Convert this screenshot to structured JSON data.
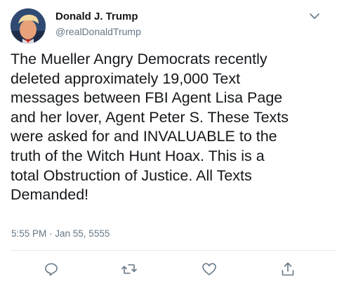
{
  "tweet": {
    "author_name": "Donald J. Trump",
    "author_handle": "@realDonaldTrump",
    "text": "The Mueller Angry Democrats recently\ndeleted approximately 19,000 Text\nmessages between FBI Agent Lisa Page\nand her lover, Agent Peter S. These Texts\nwere asked for and INVALUABLE to the\ntruth of the Witch Hunt Hoax. This is a\ntotal Obstruction of Justice. All Texts\nDemanded!",
    "timestamp": "5:55 PM · Jan 55, 5555"
  },
  "icons": {
    "more": "chevron-down-icon",
    "reply": "reply-icon",
    "retweet": "retweet-icon",
    "like": "heart-icon",
    "share": "share-icon"
  },
  "colors": {
    "text": "#14171a",
    "secondary": "#657786",
    "icon": "#657786",
    "divider": "#e6ecf0"
  }
}
